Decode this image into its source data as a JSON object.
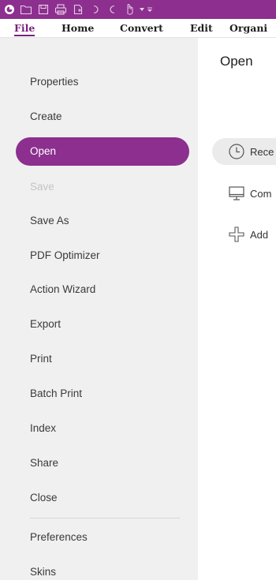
{
  "menu": {
    "items": [
      {
        "label": "File",
        "active": true
      },
      {
        "label": "Home"
      },
      {
        "label": "Convert"
      },
      {
        "label": "Edit"
      },
      {
        "label": "Organi"
      }
    ]
  },
  "sidebar": {
    "items": [
      {
        "label": "Properties"
      },
      {
        "label": "Create"
      },
      {
        "label": "Open",
        "selected": true
      },
      {
        "label": "Save",
        "disabled": true
      },
      {
        "label": "Save As"
      },
      {
        "label": "PDF Optimizer"
      },
      {
        "label": "Action Wizard"
      },
      {
        "label": "Export"
      },
      {
        "label": "Print"
      },
      {
        "label": "Batch Print"
      },
      {
        "label": "Index"
      },
      {
        "label": "Share"
      },
      {
        "label": "Close"
      },
      {
        "label": "Preferences"
      },
      {
        "label": "Skins"
      }
    ]
  },
  "main": {
    "title": "Open",
    "options": [
      {
        "label": "Rece",
        "icon": "clock-icon",
        "active": true
      },
      {
        "label": "Com",
        "icon": "computer-icon"
      },
      {
        "label": "Add",
        "icon": "add-place-icon"
      }
    ]
  },
  "colors": {
    "accent": "#8c2f8e",
    "sidebar_bg": "#f0f0f0",
    "disabled_text": "#c4c4c4"
  }
}
